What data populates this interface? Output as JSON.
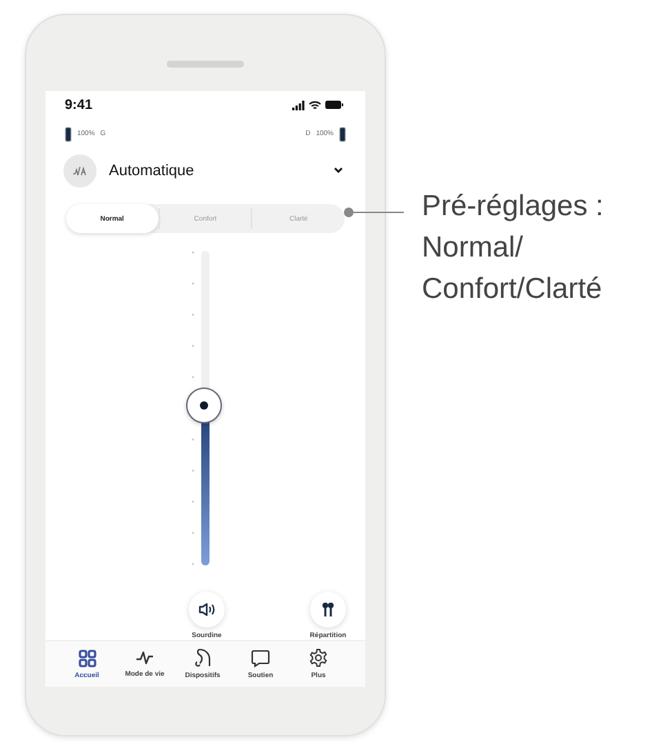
{
  "status_bar": {
    "time": "9:41"
  },
  "batteries": [
    {
      "percent": "100%",
      "side": "G"
    },
    {
      "side": "D",
      "percent": "100%"
    }
  ],
  "program": {
    "name": "Automatique"
  },
  "presets": [
    {
      "label": "Normal",
      "selected": true
    },
    {
      "label": "Confort",
      "selected": false
    },
    {
      "label": "Clarté",
      "selected": false
    }
  ],
  "volume": {
    "level": 0.51
  },
  "actions": [
    {
      "label": "Sourdine",
      "kind": "mute"
    },
    {
      "label": "Répartition",
      "kind": "balance"
    }
  ],
  "nav": [
    {
      "label": "Accueil",
      "kind": "home",
      "selected": true
    },
    {
      "label": "Mode de vie",
      "kind": "activity",
      "selected": false
    },
    {
      "label": "Dispositifs",
      "kind": "device",
      "selected": false
    },
    {
      "label": "Soutien",
      "kind": "chat",
      "selected": false
    },
    {
      "label": "Plus",
      "kind": "settings",
      "selected": false
    }
  ],
  "callout": {
    "lines": [
      "Pré-réglages :",
      "Normal/",
      "Confort/Clarté"
    ]
  }
}
